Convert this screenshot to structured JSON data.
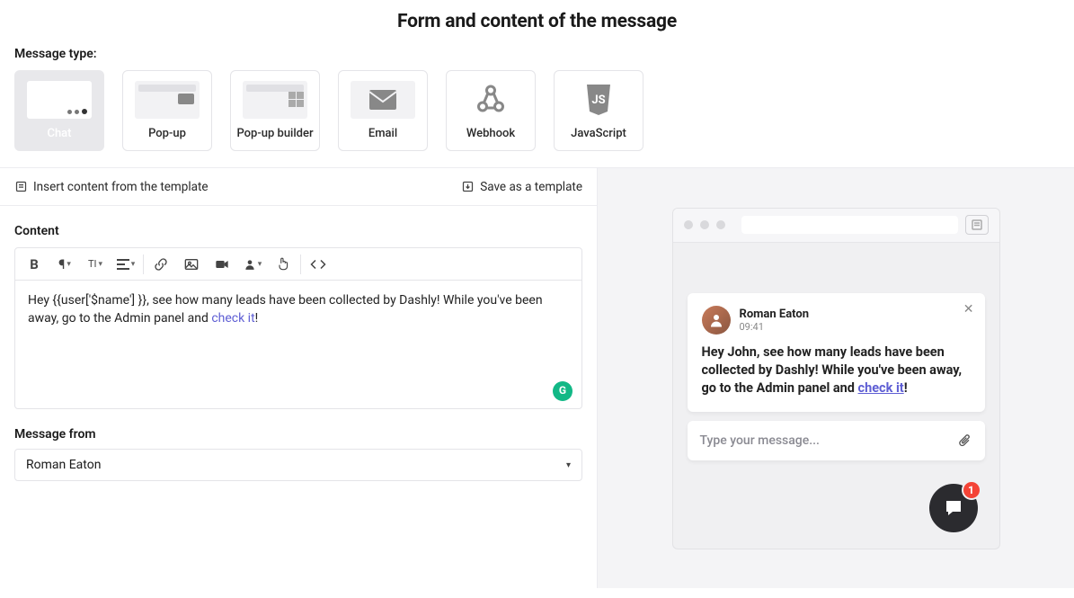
{
  "title": "Form and content of the message",
  "message_type_label": "Message type:",
  "message_types": [
    {
      "label": "Chat",
      "selected": true
    },
    {
      "label": "Pop-up"
    },
    {
      "label": "Pop-up builder"
    },
    {
      "label": "Email"
    },
    {
      "label": "Webhook"
    },
    {
      "label": "JavaScript"
    }
  ],
  "template_bar": {
    "insert": "Insert content from the template",
    "save": "Save as a template"
  },
  "content_label": "Content",
  "editor": {
    "text_a": "Hey {{user['$name'] }}, see how many leads have been collected by Dashly! While you've been away, go to the Admin panel and ",
    "link": "check it",
    "text_b": "!"
  },
  "g_badge": "G",
  "message_from_label": "Message from",
  "message_from_value": "Roman Eaton",
  "preview": {
    "author": "Roman Eaton",
    "time": "09:41",
    "text_a": "Hey John, see how many leads have been collected by Dashly! While you've been away, go to the Admin panel and ",
    "link": "check it",
    "text_b": "!",
    "reply_placeholder": "Type your message...",
    "badge": "1"
  }
}
